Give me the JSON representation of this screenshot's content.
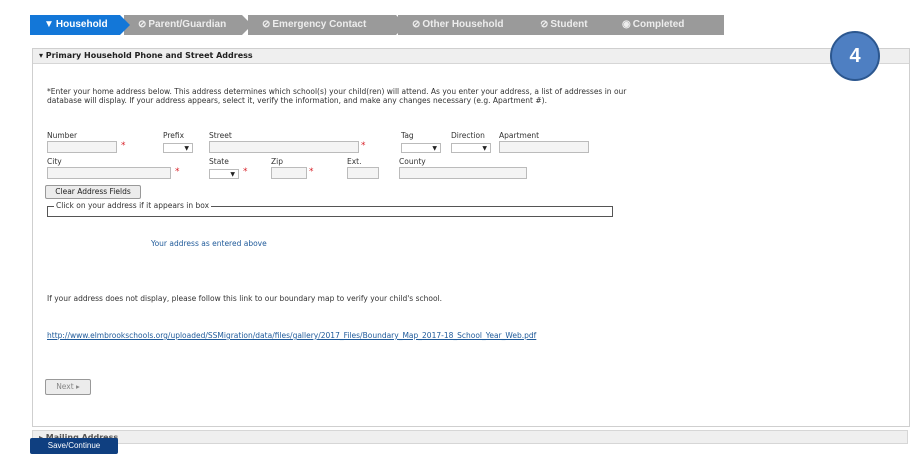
{
  "steps": [
    {
      "label": "Household",
      "icon": "▼",
      "active": true
    },
    {
      "label": "Parent/Guardian",
      "icon": "⃠"
    },
    {
      "label": "Emergency Contact",
      "icon": "⃠"
    },
    {
      "label": "Other Household",
      "icon": "⃠"
    },
    {
      "label": "Student",
      "icon": "⃠"
    },
    {
      "label": "Completed",
      "icon": "●"
    }
  ],
  "section": {
    "title": "▾ Primary Household Phone and Street Address",
    "intro": "*Enter your home address below. This address determines which school(s) your child(ren) will attend. As you enter your address, a list of addresses in our database will display. If your address appears, select it, verify the information, and make any changes necessary (e.g. Apartment #).",
    "fields": {
      "number": "Number",
      "prefix": "Prefix",
      "street": "Street",
      "tag": "Tag",
      "direction": "Direction",
      "apartment": "Apartment",
      "city": "City",
      "state": "State",
      "zip": "Zip",
      "ext": "Ext.",
      "county": "County"
    },
    "clear_button": "Clear Address Fields",
    "address_box_label": "Click on your address if it appears in box",
    "address_entered": "Your address as entered above",
    "boundary_text": "If your address does not display, please follow this link to our boundary map to verify your child's school.",
    "boundary_link": "http://www.elmbrookschools.org/uploaded/SSMigration/data/files/gallery/2017_Files/Boundary_Map_2017-18_School_Year_Web.pdf",
    "next_button": "Next ▸"
  },
  "mailing_title": "▸ Mailing Address",
  "save_button": "Save/Continue",
  "badge": "4"
}
